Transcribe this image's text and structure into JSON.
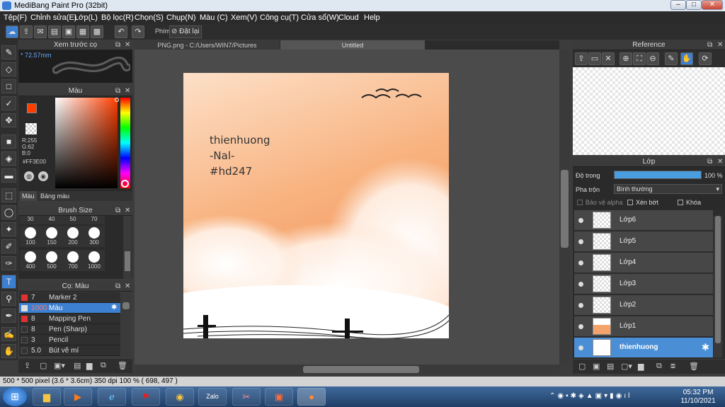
{
  "window": {
    "title": "MediBang Paint Pro (32bit)"
  },
  "menu": [
    "Tệp(F)",
    "Chỉnh sửa(E)",
    "Lớp(L)",
    "Bộ lọc(R)",
    "Chọn(S)",
    "Chụp(N)",
    "Màu (C)",
    "Xem(V)",
    "Công cụ(T)",
    "Cửa sổ(W)",
    "Cloud",
    "Help"
  ],
  "toolbar": {
    "snap_label": "Phím",
    "snap_value": "Đặt lại"
  },
  "preview": {
    "title": "Xem trước cọ",
    "size": "* 72.57mm"
  },
  "color_panel": {
    "title": "Màu",
    "r": "R:255",
    "g": "G:62",
    "b": "B:0",
    "hex": "#FF3E00",
    "tab_color": "Màu",
    "tab_palette": "Bảng màu",
    "fg": "#ff3e00"
  },
  "brush_size": {
    "title": "Brush Size",
    "row1": [
      "30",
      "40",
      "50",
      "70"
    ],
    "row2": [
      "100",
      "150",
      "200",
      "300"
    ],
    "row3": [
      "400",
      "500",
      "700",
      "1000"
    ]
  },
  "brush_list": {
    "title": "Cọ: Màu",
    "items": [
      {
        "size": "7",
        "name": "Marker 2",
        "color": "#e03030"
      },
      {
        "size": "1000",
        "name": "Màu",
        "color": "#dddddd"
      },
      {
        "size": "8",
        "name": "Mapping Pen",
        "color": "#e03030"
      },
      {
        "size": "8",
        "name": "Pen (Sharp)",
        "color": "#333333"
      },
      {
        "size": "3",
        "name": "Pencil",
        "color": "#333333"
      },
      {
        "size": "5.0",
        "name": "Bút vẽ mí",
        "color": "#333333"
      }
    ]
  },
  "tabs": {
    "file": "PNG.png - C:/Users/WIN7/Pictures",
    "untitled": "Untitled"
  },
  "canvas_text": {
    "line1": "thienhuong",
    "line2": "-Nal-",
    "line3": "#hd247"
  },
  "reference": {
    "title": "Reference"
  },
  "layers": {
    "title": "Lớp",
    "opacity_label": "Độ trong",
    "opacity_value": "100 %",
    "opacity_fraction": 1.0,
    "blend_label": "Pha trộn",
    "blend_value": "Bình thường",
    "alpha_lock": "Bảo vệ alpha",
    "clip": "Xén bớt",
    "lock": "Khóa",
    "items": [
      "Lớp6",
      "Lớp5",
      "Lớp4",
      "Lớp3",
      "Lớp2",
      "Lớp1",
      "thienhuong"
    ]
  },
  "status": {
    "text": "500 * 500 pixel  (3.6 * 3.6cm)  350 dpi  100 %  ( 698, 497 )"
  },
  "clock": {
    "time": "05:32 PM",
    "date": "11/10/2021"
  }
}
